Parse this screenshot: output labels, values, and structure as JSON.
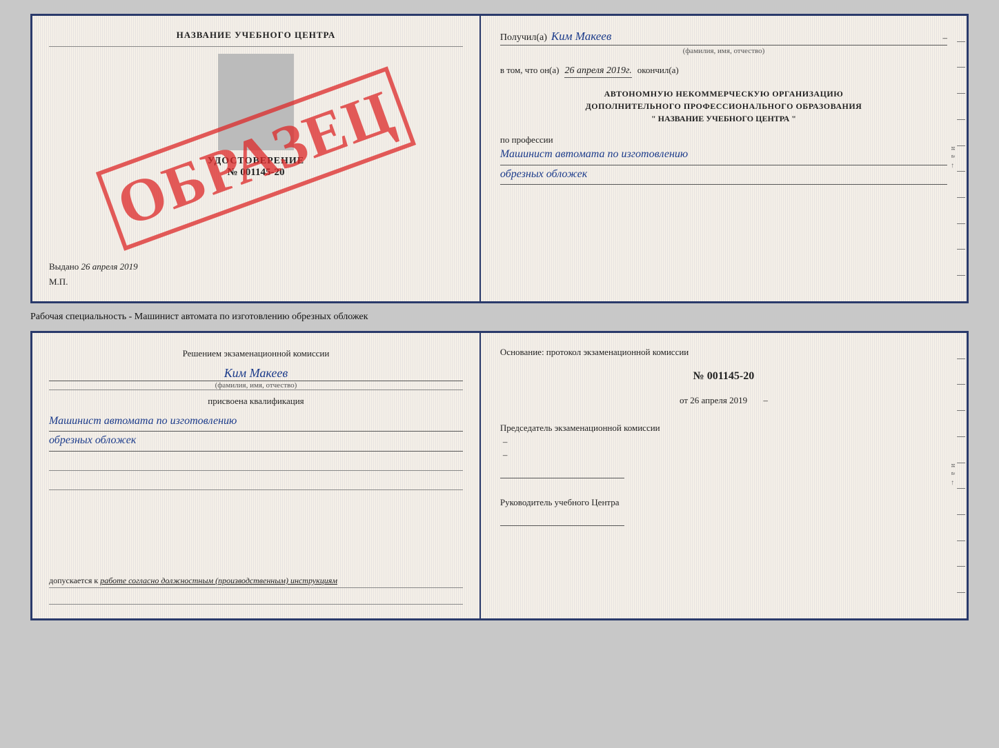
{
  "top_cert": {
    "left": {
      "school_title": "НАЗВАНИЕ УЧЕБНОГО ЦЕНТРА",
      "watermark": "ОБРАЗЕЦ",
      "udost_label": "УДОСТОВЕРЕНИЕ",
      "udost_number": "№ 001145-20",
      "vydano_label": "Выдано",
      "vydano_date": "26 апреля 2019",
      "mp_label": "М.П."
    },
    "right": {
      "poluchil_prefix": "Получил(а)",
      "poluchil_name": "Ким Макеев",
      "fio_subtitle": "(фамилия, имя, отчество)",
      "vtom_prefix": "в том, что он(а)",
      "vtom_date": "26 апреля 2019г.",
      "okonchil": "окончил(а)",
      "org_line1": "АВТОНОМНУЮ НЕКОММЕРЧЕСКУЮ ОРГАНИЗАЦИЮ",
      "org_line2": "ДОПОЛНИТЕЛЬНОГО ПРОФЕССИОНАЛЬНОГО ОБРАЗОВАНИЯ",
      "org_line3": "\"  НАЗВАНИЕ УЧЕБНОГО ЦЕНТРА  \"",
      "po_professii": "по профессии",
      "professiya_line1": "Машинист автомата по изготовлению",
      "professiya_line2": "обрезных обложек"
    }
  },
  "between_label": "Рабочая специальность - Машинист автомата по изготовлению обрезных обложек",
  "bottom_cert": {
    "left": {
      "resheniyem_line1": "Решением экзаменационной комиссии",
      "kim_makeev": "Ким Макеев",
      "fio_subtitle": "(фамилия, имя, отчество)",
      "prisvoena": "присвоена квалификация",
      "kvalif_line1": "Машинист автомата по изготовлению",
      "kvalif_line2": "обрезных обложек",
      "dopusk_prefix": "допускается к",
      "dopusk_text": "работе согласно должностным (производственным) инструкциям"
    },
    "right": {
      "osnovanie_label": "Основание: протокол экзаменационной комиссии",
      "protocol_number": "№ 001145-20",
      "protocol_date_prefix": "от",
      "protocol_date": "26 апреля 2019",
      "predsedatel_label": "Председатель экзаменационной комиссии",
      "rukovoditel_label": "Руководитель учебного Центра"
    }
  }
}
